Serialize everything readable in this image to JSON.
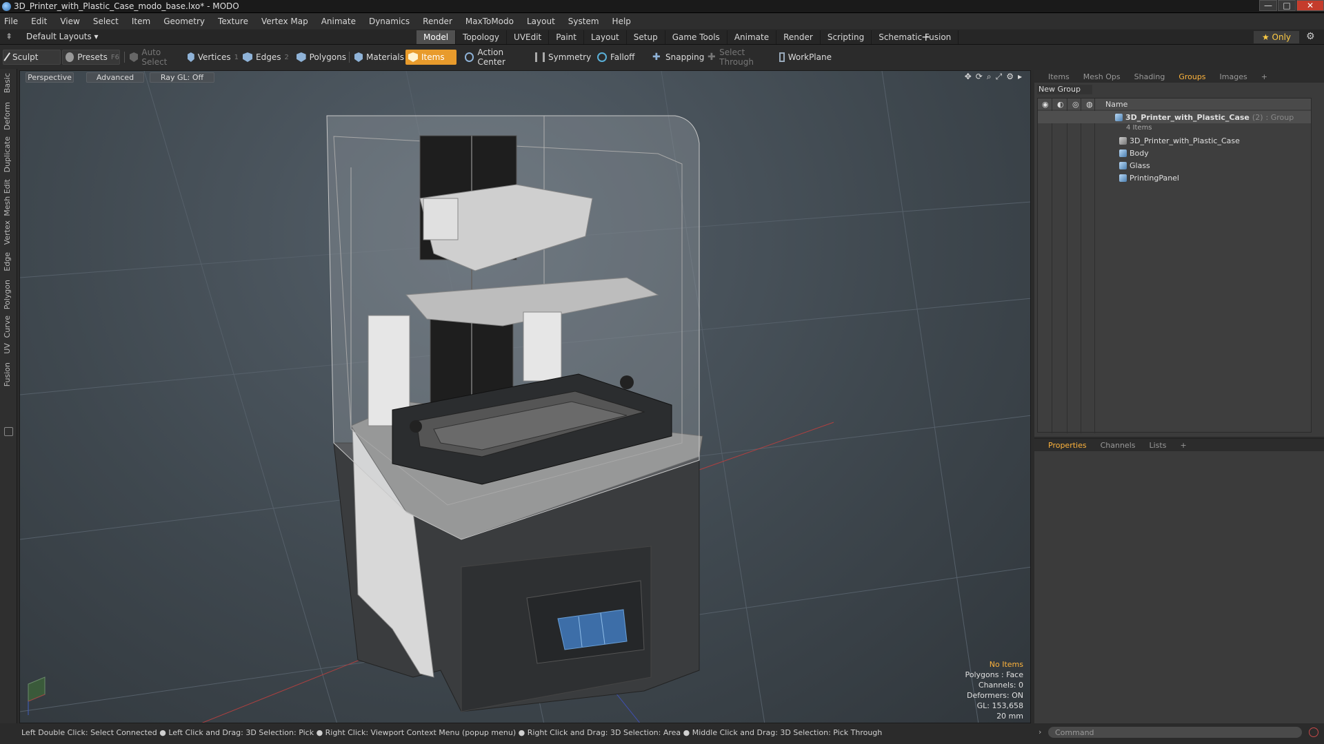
{
  "window": {
    "title": "3D_Printer_with_Plastic_Case_modo_base.lxo* - MODO",
    "min_symbol": "—",
    "max_symbol": "□",
    "close_symbol": "✕"
  },
  "menu": [
    "File",
    "Edit",
    "View",
    "Select",
    "Item",
    "Geometry",
    "Texture",
    "Vertex Map",
    "Animate",
    "Dynamics",
    "Render",
    "MaxToModo",
    "Layout",
    "System",
    "Help"
  ],
  "layoutbar": {
    "layouts_label": "Default Layouts ▾",
    "tabs": [
      "Model",
      "Topology",
      "UVEdit",
      "Paint",
      "Layout",
      "Setup",
      "Game Tools",
      "Animate",
      "Render",
      "Scripting",
      "Schematic Fusion"
    ],
    "active_tab": "Model",
    "plus": "+",
    "only_label": "★  Only"
  },
  "toolbar": {
    "sculpt": "Sculpt",
    "presets": "Presets",
    "presets_key": "F6",
    "auto_select": "Auto Select",
    "vertices": "Vertices",
    "vertices_key": "1",
    "edges": "Edges",
    "edges_key": "2",
    "polygons": "Polygons",
    "materials": "Materials",
    "items": "Items",
    "action_center": "Action Center",
    "symmetry": "Symmetry",
    "falloff": "Falloff",
    "snapping": "Snapping",
    "select_through": "Select Through",
    "workplane": "WorkPlane"
  },
  "left_tabs": [
    "Basic",
    "Deform",
    "Duplicate",
    "Mesh Edit",
    "Vertex",
    "Edge",
    "Polygon",
    "Curve",
    "UV",
    "Fusion"
  ],
  "viewport": {
    "view_mode": "Perspective",
    "shading": "Advanced",
    "raygl": "Ray GL: Off",
    "stats": {
      "selection": "No Items",
      "polygons": "Polygons : Face",
      "channels": "Channels: 0",
      "deformers": "Deformers: ON",
      "gl": "GL: 153,658",
      "scale": "20 mm"
    }
  },
  "statusbar": "Left Double Click: Select Connected ● Left Click and Drag: 3D Selection: Pick ● Right Click: Viewport Context Menu (popup menu) ● Right Click and Drag: 3D Selection: Area ● Middle Click and Drag: 3D Selection: Pick Through",
  "groups_panel": {
    "tabs": [
      "Items",
      "Mesh Ops",
      "Shading",
      "Groups",
      "Images"
    ],
    "active_tab": "Groups",
    "plus": "+",
    "new_group": "New Group",
    "name_header": "Name",
    "group_name": "3D_Printer_with_Plastic_Case",
    "group_count": "(2)",
    "group_type": ": Group",
    "group_items": "4 Items",
    "children": [
      "3D_Printer_with_Plastic_Case",
      "Body",
      "Glass",
      "PrintingPanel"
    ]
  },
  "props_panel": {
    "tabs": [
      "Properties",
      "Channels",
      "Lists"
    ],
    "active_tab": "Properties",
    "plus": "+"
  },
  "command": {
    "placeholder": "Command"
  },
  "colors": {
    "accent": "#e89b2c",
    "highlight_text": "#ffb43c",
    "close_button": "#c43c2c"
  }
}
